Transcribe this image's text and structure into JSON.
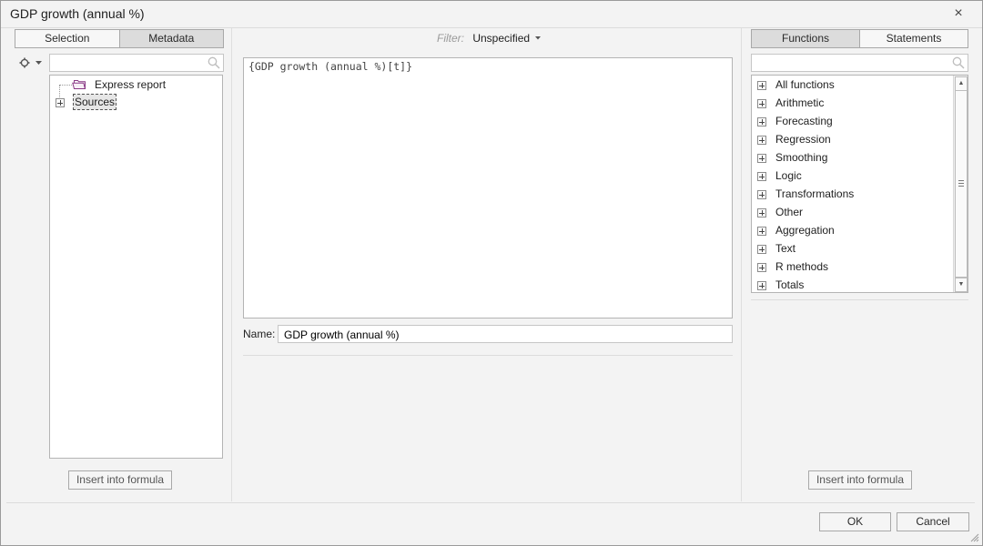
{
  "dialog": {
    "title": "GDP growth (annual %)"
  },
  "left": {
    "tabs": [
      {
        "label": "Selection",
        "active": false
      },
      {
        "label": "Metadata",
        "active": true
      }
    ],
    "search": {
      "value": "",
      "placeholder": ""
    },
    "tree": [
      {
        "label": "Express report",
        "icon": "folder-icon"
      },
      {
        "label": "Sources",
        "icon": "expand-icon"
      }
    ],
    "insert_label": "Insert into formula"
  },
  "middle": {
    "filter_label": "Filter:",
    "filter_value": "Unspecified",
    "formula": "{GDP growth (annual %)[t]}",
    "name_label": "Name:",
    "name_value": "GDP growth (annual %)"
  },
  "right": {
    "tabs": [
      {
        "label": "Functions",
        "active": true
      },
      {
        "label": "Statements",
        "active": false
      }
    ],
    "search": {
      "value": "",
      "placeholder": ""
    },
    "functions": [
      "All functions",
      "Arithmetic",
      "Forecasting",
      "Regression",
      "Smoothing",
      "Logic",
      "Transformations",
      "Other",
      "Aggregation",
      "Text",
      "R methods",
      "Totals"
    ],
    "insert_label": "Insert into formula"
  },
  "footer": {
    "ok_label": "OK",
    "cancel_label": "Cancel"
  },
  "colors": {
    "background": "#f3f3f3",
    "active_tab": "#dcdcdc",
    "folder_accent": "#8a3a86"
  }
}
